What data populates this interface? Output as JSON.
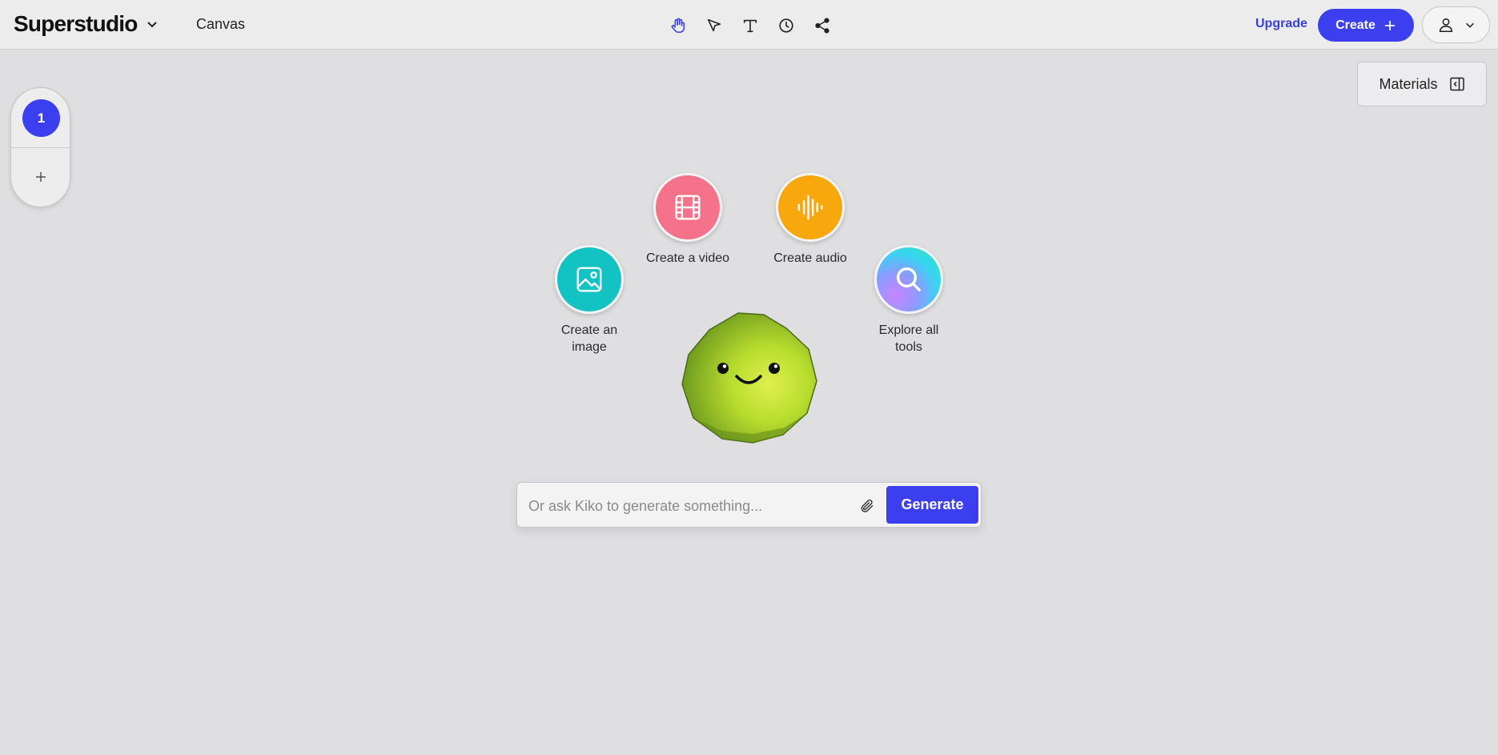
{
  "header": {
    "brand": "Superstudio",
    "section": "Canvas",
    "tools": [
      {
        "name": "hand-icon",
        "active": true
      },
      {
        "name": "cursor-arrow-icon",
        "active": false
      },
      {
        "name": "text-icon",
        "active": false
      },
      {
        "name": "clock-icon",
        "active": false
      },
      {
        "name": "share-icon",
        "active": false
      }
    ],
    "upgrade_label": "Upgrade",
    "create_label": "Create"
  },
  "materials": {
    "label": "Materials"
  },
  "pages": {
    "current": "1"
  },
  "actions": {
    "image": "Create an image",
    "video": "Create a video",
    "audio": "Create audio",
    "explore": "Explore all tools"
  },
  "prompt": {
    "placeholder": "Or ask Kiko to generate something...",
    "generate_label": "Generate"
  },
  "colors": {
    "accent": "#3b3ff0",
    "image": "#13c2c3",
    "video": "#f6728a",
    "audio": "#f8a70c"
  }
}
